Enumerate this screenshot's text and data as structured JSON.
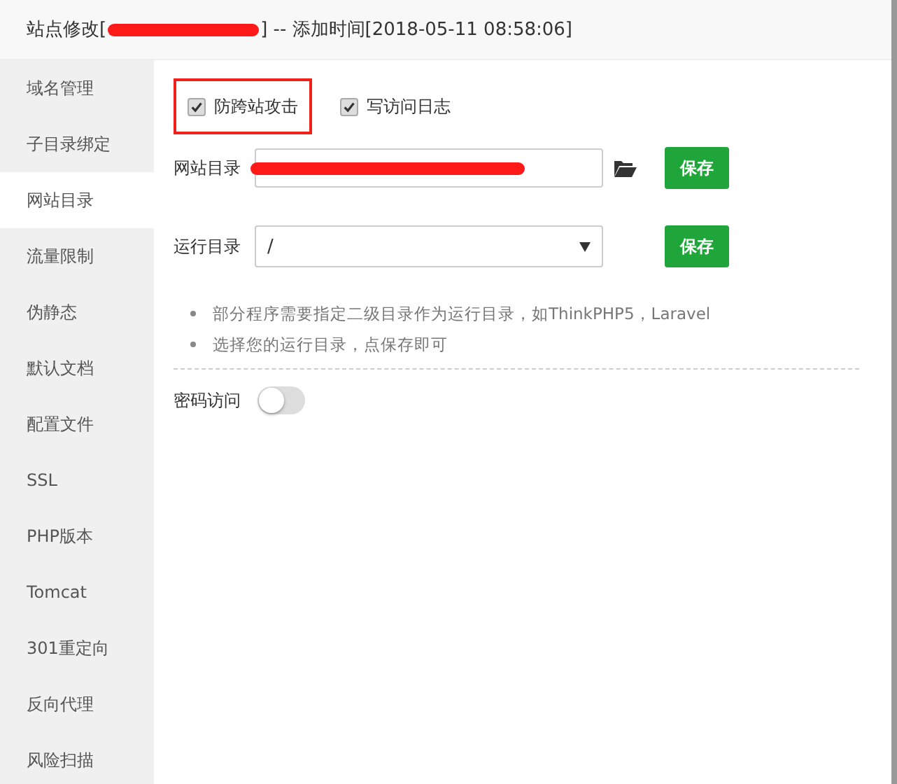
{
  "window": {
    "title_prefix": "站点修改[",
    "title_redacted": true,
    "title_suffix": "] -- 添加时间[2018-05-11 08:58:06]"
  },
  "sidebar": {
    "items": [
      {
        "label": "域名管理",
        "selected": false
      },
      {
        "label": "子目录绑定",
        "selected": false
      },
      {
        "label": "网站目录",
        "selected": true
      },
      {
        "label": "流量限制",
        "selected": false
      },
      {
        "label": "伪静态",
        "selected": false
      },
      {
        "label": "默认文档",
        "selected": false
      },
      {
        "label": "配置文件",
        "selected": false
      },
      {
        "label": "SSL",
        "selected": false
      },
      {
        "label": "PHP版本",
        "selected": false
      },
      {
        "label": "Tomcat",
        "selected": false
      },
      {
        "label": "301重定向",
        "selected": false
      },
      {
        "label": "反向代理",
        "selected": false
      },
      {
        "label": "风险扫描",
        "selected": false
      }
    ]
  },
  "options": [
    {
      "label": "防跨站攻击",
      "checked": true,
      "highlighted": true
    },
    {
      "label": "写访问日志",
      "checked": true,
      "highlighted": false
    }
  ],
  "site_dir": {
    "label": "网站目录",
    "redacted": true,
    "button": "保存"
  },
  "run_dir": {
    "label": "运行目录",
    "value": "/",
    "button": "保存"
  },
  "tips": [
    "部分程序需要指定二级目录作为运行目录，如ThinkPHP5，Laravel",
    "选择您的运行目录，点保存即可"
  ],
  "password_access": {
    "label": "密码访问",
    "on": false
  }
}
